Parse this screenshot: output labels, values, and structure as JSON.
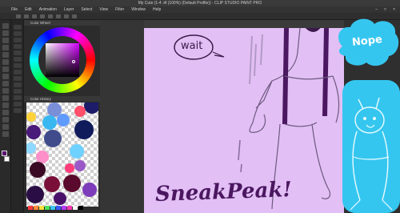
{
  "window": {
    "title": "My Cute (1-4 .tif (100%) (Default Profile)) - CLIP STUDIO PAINT PRO"
  },
  "menu": {
    "items": [
      "File",
      "Edit",
      "Animation",
      "Layer",
      "Select",
      "View",
      "Filter",
      "Window",
      "Help"
    ]
  },
  "panels": {
    "color_wheel_title": "Color Wheel",
    "color_set_title": "Color History"
  },
  "colors": {
    "main": "#5a1070",
    "sub": "#ffffff",
    "canvas": "#e2bff4",
    "ink": "#4a1760",
    "sticker": "#35c6f0"
  },
  "canvas": {
    "speech_bubble": "wait",
    "caption": "SneakPeak!"
  },
  "stickers": {
    "nope_text": "Nope"
  },
  "icons": [
    "pen-tool-icon",
    "brush-tool-icon",
    "eraser-tool-icon",
    "fill-tool-icon",
    "move-tool-icon",
    "select-tool-icon",
    "eyedropper-tool-icon",
    "text-tool-icon"
  ]
}
